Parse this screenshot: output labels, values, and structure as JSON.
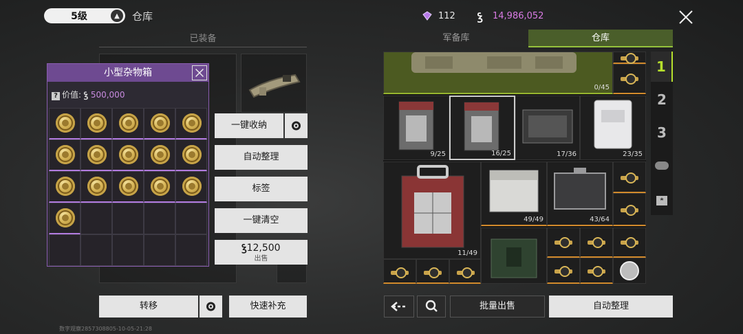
{
  "header": {
    "level": "5级",
    "title": "仓库",
    "gems": "112",
    "currency_symbol": "ꝣ",
    "currency": "14,986,052"
  },
  "left": {
    "tab_label": "已装备",
    "buttons": {
      "collect_all": "一键收纳",
      "auto_sort": "自动整理",
      "tags": "标签",
      "clear_all": "一键清空",
      "sell_price": "12,500",
      "sell_label": "出售",
      "transfer": "转移",
      "quick_refill": "快速补充"
    }
  },
  "container": {
    "title": "小型杂物箱",
    "value_label": "价值:",
    "value_symbol": "ꝣ",
    "value": "500,000",
    "coin_count": 16
  },
  "right": {
    "tabs": [
      "军备库",
      "仓库"
    ],
    "active_tab": 1,
    "side_tabs": [
      "1",
      "2",
      "3"
    ],
    "active_side_tab": 0,
    "capacities": [
      "0/45",
      "9/25",
      "16/25",
      "17/36",
      "23/35",
      "11/49",
      "49/49",
      "43/64"
    ],
    "buttons": {
      "batch_sell": "批量出售",
      "auto_sort": "自动整理"
    }
  },
  "footer": {
    "id_text": "数字观察2857308805-10-05-21:28"
  },
  "colors": {
    "accent_green": "#95c23c",
    "container_purple": "#6e4a91",
    "currency_pink": "#d97be4"
  }
}
